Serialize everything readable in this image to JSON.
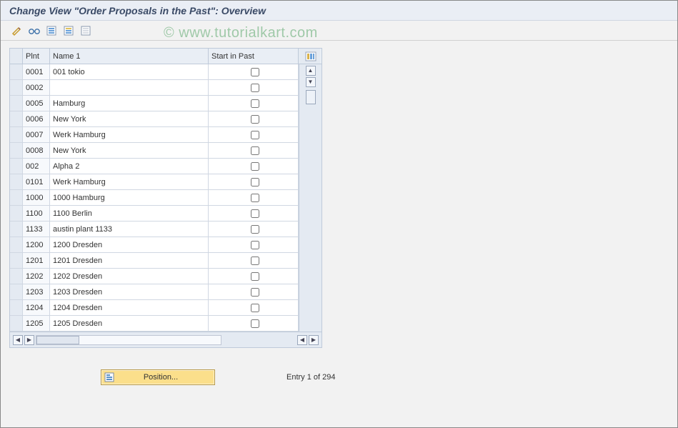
{
  "title": "Change View \"Order Proposals in the Past\": Overview",
  "watermark": "© www.tutorialkart.com",
  "toolbar": {
    "btn1": "display-change-toggle",
    "btn2": "other-view",
    "btn3": "select-all",
    "btn4": "select-block",
    "btn5": "deselect-all"
  },
  "table": {
    "columns": {
      "plnt": "Plnt",
      "name": "Name 1",
      "start": "Start in Past"
    },
    "rows": [
      {
        "plnt": "0001",
        "name": "001 tokio",
        "checked": false
      },
      {
        "plnt": "0002",
        "name": "",
        "checked": false
      },
      {
        "plnt": "0005",
        "name": "Hamburg",
        "checked": false
      },
      {
        "plnt": "0006",
        "name": "New York",
        "checked": false
      },
      {
        "plnt": "0007",
        "name": "Werk Hamburg",
        "checked": false
      },
      {
        "plnt": "0008",
        "name": "New York",
        "checked": false
      },
      {
        "plnt": "002",
        "name": "Alpha 2",
        "checked": false
      },
      {
        "plnt": "0101",
        "name": "Werk Hamburg",
        "checked": false
      },
      {
        "plnt": "1000",
        "name": "1000 Hamburg",
        "checked": false
      },
      {
        "plnt": "1100",
        "name": "1100 Berlin",
        "checked": false
      },
      {
        "plnt": "1133",
        "name": "austin plant 1133",
        "checked": false
      },
      {
        "plnt": "1200",
        "name": "1200 Dresden",
        "checked": false
      },
      {
        "plnt": "1201",
        "name": "1201 Dresden",
        "checked": false
      },
      {
        "plnt": "1202",
        "name": "1202 Dresden",
        "checked": false
      },
      {
        "plnt": "1203",
        "name": "1203 Dresden",
        "checked": false
      },
      {
        "plnt": "1204",
        "name": "1204 Dresden",
        "checked": false
      },
      {
        "plnt": "1205",
        "name": "1205 Dresden",
        "checked": false
      }
    ]
  },
  "footer": {
    "position_label": "Position...",
    "entry_text": "Entry 1 of 294"
  }
}
